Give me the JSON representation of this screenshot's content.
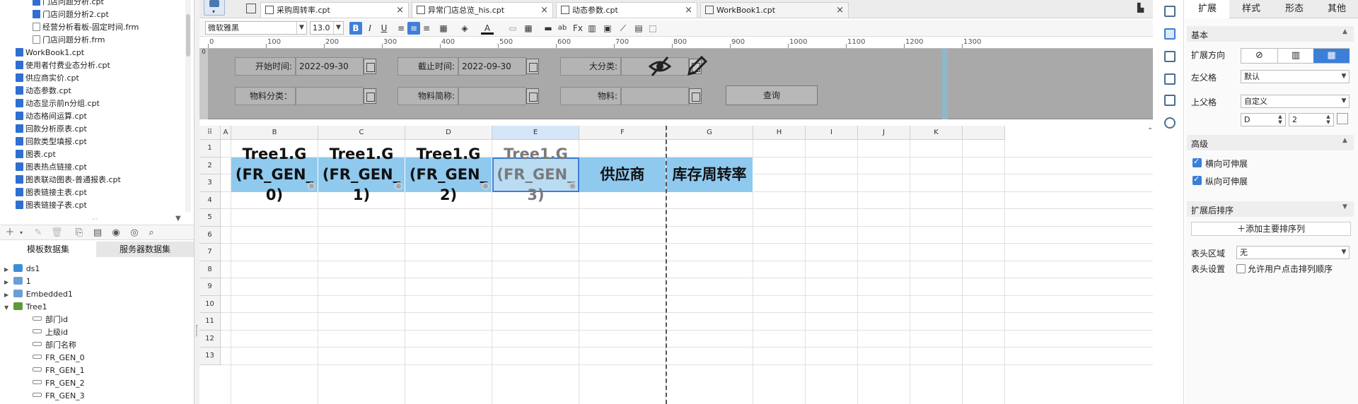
{
  "file_tree": [
    {
      "name": "门店问题分析.cpt",
      "type": "cpt",
      "indent": 1
    },
    {
      "name": "门店问题分析2.cpt",
      "type": "cpt",
      "indent": 1
    },
    {
      "name": "经营分析看板-固定时间.frm",
      "type": "frm",
      "indent": 1
    },
    {
      "name": "门店问题分析.frm",
      "type": "frm",
      "indent": 1
    },
    {
      "name": "WorkBook1.cpt",
      "type": "cpt",
      "indent": 0
    },
    {
      "name": "使用者付费业态分析.cpt",
      "type": "cpt",
      "indent": 0
    },
    {
      "name": "供应商实价.cpt",
      "type": "cpt",
      "indent": 0
    },
    {
      "name": "动态参数.cpt",
      "type": "cpt",
      "indent": 0
    },
    {
      "name": "动态显示前n分组.cpt",
      "type": "cpt",
      "indent": 0
    },
    {
      "name": "动态格间运算.cpt",
      "type": "cpt",
      "indent": 0
    },
    {
      "name": "回款分析原表.cpt",
      "type": "cpt",
      "indent": 0
    },
    {
      "name": "回款类型填报.cpt",
      "type": "cpt",
      "indent": 0
    },
    {
      "name": "图表.cpt",
      "type": "cpt",
      "indent": 0
    },
    {
      "name": "图表热点链接.cpt",
      "type": "cpt",
      "indent": 0
    },
    {
      "name": "图表联动图表-普通报表.cpt",
      "type": "cpt",
      "indent": 0
    },
    {
      "name": "图表链接主表.cpt",
      "type": "cpt",
      "indent": 0
    },
    {
      "name": "图表链接子表.cpt",
      "type": "cpt",
      "indent": 0
    }
  ],
  "dataset_tabs": [
    "模板数据集",
    "服务器数据集"
  ],
  "datasets": [
    {
      "name": "ds1",
      "level": 0,
      "icon": "database-icon"
    },
    {
      "name": "1",
      "level": 0,
      "icon": "table-icon"
    },
    {
      "name": "Embedded1",
      "level": 0,
      "icon": "table-icon"
    },
    {
      "name": "Tree1",
      "level": 0,
      "icon": "tree-icon",
      "expanded": true
    },
    {
      "name": "部门id",
      "level": 1,
      "icon": "field-icon"
    },
    {
      "name": "上级id",
      "level": 1,
      "icon": "field-icon"
    },
    {
      "name": "部门名称",
      "level": 1,
      "icon": "field-icon"
    },
    {
      "name": "FR_GEN_0",
      "level": 1,
      "icon": "field-icon"
    },
    {
      "name": "FR_GEN_1",
      "level": 1,
      "icon": "field-icon"
    },
    {
      "name": "FR_GEN_2",
      "level": 1,
      "icon": "field-icon"
    },
    {
      "name": "FR_GEN_3",
      "level": 1,
      "icon": "field-icon"
    }
  ],
  "tabs": [
    {
      "label": "采购周转率.cpt"
    },
    {
      "label": "异常门店总览_his.cpt"
    },
    {
      "label": "动态参数.cpt"
    },
    {
      "label": "WorkBook1.cpt"
    }
  ],
  "format": {
    "font": "微软雅黑",
    "size": "13.0"
  },
  "ruler_ticks": [
    "0",
    "100",
    "200",
    "300",
    "400",
    "500",
    "600",
    "700",
    "800",
    "900",
    "1000",
    "1100",
    "1200",
    "1300"
  ],
  "params": {
    "start_label": "开始时间:",
    "start_value": "2022-09-30",
    "end_label": "截止时间:",
    "end_value": "2022-09-30",
    "category_label": "大分类:",
    "material_cat_label": "物料分类：",
    "material_short_label": "物料简称:",
    "material_label": "物料:",
    "query_label": "查询"
  },
  "columns": [
    "A",
    "B",
    "C",
    "D",
    "E",
    "F",
    "G",
    "H",
    "I",
    "J",
    "K"
  ],
  "rows": [
    "1",
    "2",
    "3",
    "4",
    "5",
    "6",
    "7",
    "8",
    "9",
    "10",
    "11",
    "12",
    "13"
  ],
  "cells": [
    {
      "text": "Tree1.G(FR_GEN_0)"
    },
    {
      "text": "Tree1.G(FR_GEN_1)"
    },
    {
      "text": "Tree1.G(FR_GEN_2)"
    },
    {
      "text": "Tree1.G(FR_GEN_3)"
    },
    {
      "text": "供应商"
    },
    {
      "text": "库存周转率"
    }
  ],
  "right_tabs": [
    "扩展",
    "样式",
    "形态",
    "其他"
  ],
  "right": {
    "basic": "基本",
    "direction_label": "扩展方向",
    "left_parent_label": "左父格",
    "left_parent_value": "默认",
    "top_parent_label": "上父格",
    "top_parent_value": "自定义",
    "top_parent_col": "D",
    "top_parent_row": "2",
    "advanced": "高级",
    "h_expand": "横向可伸展",
    "v_expand": "纵向可伸展",
    "sort_title": "扩展后排序",
    "add_sort": "添加主要排序列",
    "header_area_label": "表头区域",
    "header_area_value": "无",
    "header_setting_label": "表头设置",
    "header_setting_check": "允许用户点击排列顺序"
  }
}
